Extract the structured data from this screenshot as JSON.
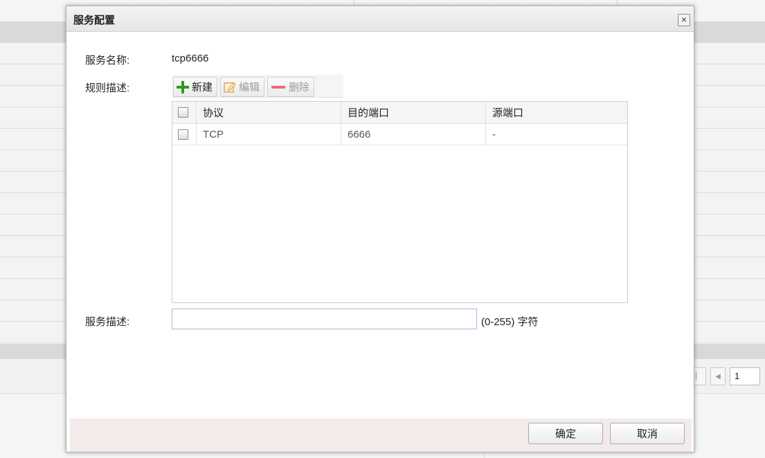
{
  "dialog": {
    "title": "服务配置",
    "close_symbol": "×"
  },
  "form": {
    "service_name_label": "服务名称:",
    "service_name_value": "tcp6666",
    "rules_label": "规则描述:",
    "service_desc_label": "服务描述:",
    "service_desc_value": "",
    "service_desc_hint": "(0-255) 字符"
  },
  "toolbar": {
    "new_label": "新建",
    "edit_label": "编辑",
    "delete_label": "删除"
  },
  "grid": {
    "columns": [
      "协议",
      "目的端口",
      "源端口"
    ],
    "rows": [
      {
        "protocol": "TCP",
        "dst_port": "6666",
        "src_port": "-"
      }
    ]
  },
  "footer": {
    "ok_label": "确定",
    "cancel_label": "取消"
  },
  "background": {
    "pager_page": "1"
  },
  "colors": {
    "add_icon": "#2e9a1e",
    "delete_icon": "#ee6a6a",
    "edit_icon": "#f0a040",
    "footer_bg": "#f2ebea"
  }
}
